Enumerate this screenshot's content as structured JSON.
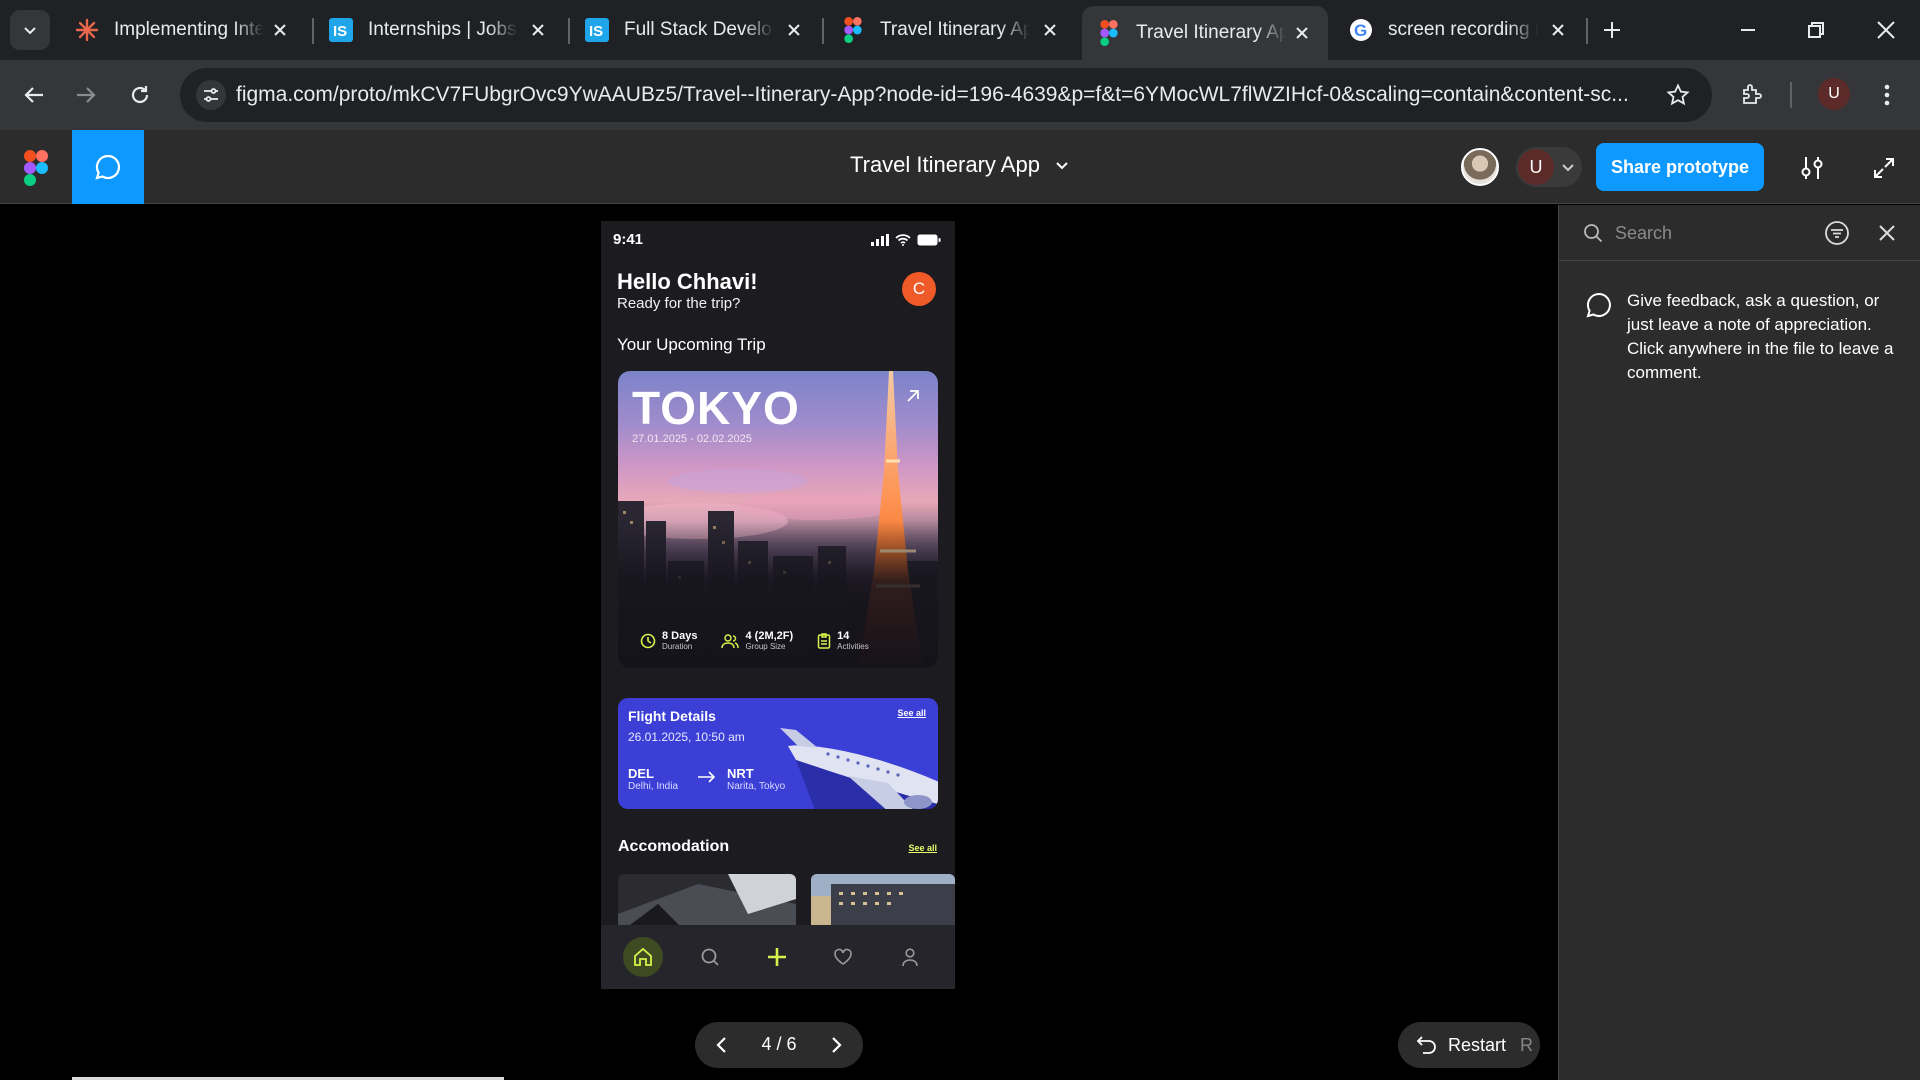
{
  "browser": {
    "tabs": [
      {
        "title": "Implementing Inte",
        "favicon": "claude-sparkle-icon"
      },
      {
        "title": "Internships | Jobs |",
        "favicon": "internshala-icon"
      },
      {
        "title": "Full Stack Develop",
        "favicon": "internshala-icon"
      },
      {
        "title": "Travel Itinerary App",
        "favicon": "figma-icon"
      },
      {
        "title": "Travel Itinerary App",
        "favicon": "figma-icon",
        "active": true
      },
      {
        "title": "screen recording ir",
        "favicon": "google-icon"
      }
    ],
    "url": "figma.com/proto/mkCV7FUbgrOvc9YwAAUBz5/Travel--Itinerary-App?node-id=196-4639&p=f&t=6YMocWL7flWZIHcf-0&scaling=contain&content-sc...",
    "profile_initial": "U"
  },
  "figma": {
    "file_title": "Travel Itinerary App",
    "user_initial": "U",
    "share_label": "Share prototype",
    "accent": "#0d99ff"
  },
  "app": {
    "status_time": "9:41",
    "greeting": "Hello Chhavi!",
    "subtitle": "Ready for the trip?",
    "avatar_initial": "C",
    "upcoming_title": "Your Upcoming Trip",
    "trip": {
      "destination": "TOKYO",
      "dates": "27.01.2025 - 02.02.2025",
      "stats": [
        {
          "value": "8 Days",
          "label": "Duration",
          "icon": "clock-icon"
        },
        {
          "value": "4 (2M,2F)",
          "label": "Group Size",
          "icon": "group-icon"
        },
        {
          "value": "14",
          "label": "Activities",
          "icon": "clipboard-icon"
        }
      ]
    },
    "flight": {
      "title": "Flight Details",
      "see_all": "See all",
      "datetime": "26.01.2025, 10:50 am",
      "from_code": "DEL",
      "from_city": "Delhi, India",
      "to_code": "NRT",
      "to_city": "Narita, Tokyo"
    },
    "accommodation": {
      "title": "Accomodation",
      "see_all": "See all"
    },
    "accent_green": "#d7f24a",
    "flight_blue": "#3b3fd6",
    "avatar_orange": "#f05a28"
  },
  "prototype": {
    "page_counter": "4 / 6",
    "restart_label": "Restart",
    "restart_key": "R"
  },
  "comments": {
    "search_placeholder": "Search",
    "hint": "Give feedback, ask a question, or just leave a note of appreciation. Click anywhere in the file to leave a comment."
  }
}
